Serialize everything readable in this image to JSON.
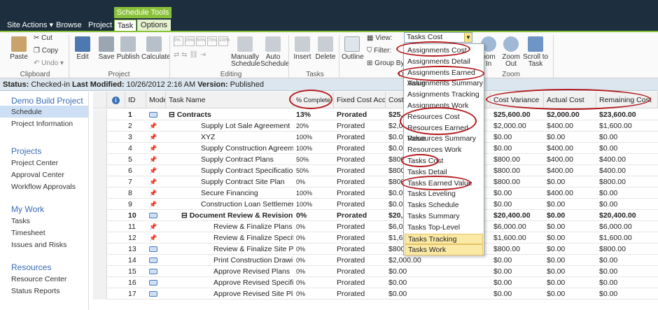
{
  "topbar": {
    "site_actions": "Site Actions ▾",
    "browse": "Browse",
    "project": "Project",
    "context_group": "Schedule Tools",
    "tab_task": "Task",
    "tab_options": "Options"
  },
  "ribbon": {
    "cut": "Cut",
    "copy": "Copy",
    "undo": "Undo",
    "paste": "Paste",
    "clipboard_group": "Clipboard",
    "edit": "Edit",
    "save": "Save",
    "publish": "Publish",
    "calculate": "Calculate",
    "project_group": "Project",
    "manually_schedule": "Manually Schedule",
    "auto_schedule": "Auto Schedule",
    "editing_group": "Editing",
    "insert": "Insert",
    "delete": "Delete",
    "tasks_group": "Tasks",
    "outline": "Outline",
    "view_label": "View:",
    "filter_label": "Filter:",
    "group_by_label": "Group By:",
    "data_group": "D",
    "zoom_in": "oom In",
    "zoom_out": "Zoom Out",
    "scroll_to_task": "Scroll to Task",
    "zoom_group": "Zoom",
    "percent_buttons": [
      "0%",
      "25%",
      "50%",
      "75%",
      "100%"
    ]
  },
  "status": {
    "status_label": "Status:",
    "status_value": "Checked-in",
    "modified_label": "Last Modified:",
    "modified_value": "10/26/2012 2:16 AM",
    "version_label": "Version:",
    "version_value": "Published"
  },
  "nav": {
    "project_title": "Demo Build Project",
    "schedule": "Schedule",
    "project_information": "Project Information",
    "projects_h": "Projects",
    "project_center": "Project Center",
    "approval_center": "Approval Center",
    "workflow_approvals": "Workflow Approvals",
    "mywork_h": "My Work",
    "tasks": "Tasks",
    "timesheet": "Timesheet",
    "issues_risks": "Issues and Risks",
    "resources_h": "Resources",
    "resource_center": "Resource Center",
    "status_reports": "Status Reports"
  },
  "view_dropdown": {
    "selected": "Tasks Cost",
    "options": [
      "Assignments Cost",
      "Assignments Detail",
      "Assignments Earned Value",
      "Assignments Summary",
      "Assignments Tracking",
      "Assignments Work",
      "Resources Cost",
      "Resources Earned Value",
      "Resources Summary",
      "Resources Work",
      "Tasks Cost",
      "Tasks Detail",
      "Tasks Earned Value",
      "Tasks Leveling",
      "Tasks Schedule",
      "Tasks Summary",
      "Tasks Top-Level",
      "Tasks Tracking",
      "Tasks Work"
    ]
  },
  "columns": {
    "id": "ID",
    "mode": "Mode",
    "task_name": "Task Name",
    "pct_complete": "% Complete",
    "fixed_cost_accrual": "Fixed Cost Accrual",
    "cost": "Cost",
    "cost_variance": "Cost Variance",
    "actual_cost": "Actual Cost",
    "remaining_cost": "Remaining Cost"
  },
  "rows": [
    {
      "id": "1",
      "name": "Contracts",
      "pct": "13%",
      "accrual": "Prorated",
      "cost": "$25,",
      "variance": "$25,600.00",
      "actual": "$2,000.00",
      "remaining": "$23,600.00",
      "summary": true,
      "level": 0,
      "mode": "auto"
    },
    {
      "id": "2",
      "name": "Supply Lot Sale Agreement",
      "pct": "20%",
      "accrual": "Prorated",
      "cost": "$2,0",
      "variance": "$2,000.00",
      "actual": "$400.00",
      "remaining": "$1,600.00",
      "summary": false,
      "level": 1,
      "mode": "manual"
    },
    {
      "id": "3",
      "name": "XYZ",
      "pct": "100%",
      "accrual": "Prorated",
      "cost": "$0.0",
      "variance": "$0.00",
      "actual": "$0.00",
      "remaining": "$0.00",
      "summary": false,
      "level": 1,
      "mode": "manual"
    },
    {
      "id": "4",
      "name": "Supply Construction Agreement",
      "pct": "100%",
      "accrual": "Prorated",
      "cost": "$0.0",
      "variance": "$0.00",
      "actual": "$400.00",
      "remaining": "$0.00",
      "summary": false,
      "level": 1,
      "mode": "manual"
    },
    {
      "id": "5",
      "name": "Supply Contract Plans",
      "pct": "50%",
      "accrual": "Prorated",
      "cost": "$800",
      "variance": "$800.00",
      "actual": "$400.00",
      "remaining": "$400.00",
      "summary": false,
      "level": 1,
      "mode": "manual"
    },
    {
      "id": "6",
      "name": "Supply Contract Specifications",
      "pct": "50%",
      "accrual": "Prorated",
      "cost": "$800",
      "variance": "$800.00",
      "actual": "$400.00",
      "remaining": "$400.00",
      "summary": false,
      "level": 1,
      "mode": "manual"
    },
    {
      "id": "7",
      "name": "Supply Contract Site Plan",
      "pct": "0%",
      "accrual": "Prorated",
      "cost": "$800",
      "variance": "$800.00",
      "actual": "$0.00",
      "remaining": "$800.00",
      "summary": false,
      "level": 1,
      "mode": "manual"
    },
    {
      "id": "8",
      "name": "Secure Financing",
      "pct": "100%",
      "accrual": "Prorated",
      "cost": "$0.0",
      "variance": "$0.00",
      "actual": "$400.00",
      "remaining": "$0.00",
      "summary": false,
      "level": 1,
      "mode": "manual"
    },
    {
      "id": "9",
      "name": "Construction Loan Settlement",
      "pct": "100%",
      "accrual": "Prorated",
      "cost": "$0.0",
      "variance": "$0.00",
      "actual": "$0.00",
      "remaining": "$0.00",
      "summary": false,
      "level": 1,
      "mode": "manual"
    },
    {
      "id": "10",
      "name": "Document Review & Revision",
      "pct": "0%",
      "accrual": "Prorated",
      "cost": "$20,",
      "variance": "$20,400.00",
      "actual": "$0.00",
      "remaining": "$20,400.00",
      "summary": true,
      "level": 1,
      "mode": "auto"
    },
    {
      "id": "11",
      "name": "Review & Finalize Plans",
      "pct": "0%",
      "accrual": "Prorated",
      "cost": "$6,0",
      "variance": "$6,000.00",
      "actual": "$0.00",
      "remaining": "$6,000.00",
      "summary": false,
      "level": 2,
      "mode": "manual"
    },
    {
      "id": "12",
      "name": "Review & Finalize Specifications",
      "pct": "0%",
      "accrual": "Prorated",
      "cost": "$1,6",
      "variance": "$1,600.00",
      "actual": "$0.00",
      "remaining": "$1,600.00",
      "summary": false,
      "level": 2,
      "mode": "manual"
    },
    {
      "id": "13",
      "name": "Review & Finalize Site Plan",
      "pct": "0%",
      "accrual": "Prorated",
      "cost": "$800",
      "variance": "$800.00",
      "actual": "$0.00",
      "remaining": "$800.00",
      "summary": false,
      "level": 2,
      "mode": "auto"
    },
    {
      "id": "14",
      "name": "Print Construction Drawings",
      "pct": "0%",
      "accrual": "Prorated",
      "cost": "$2,000.00",
      "variance": "$0.00",
      "actual": "$0.00",
      "remaining": "$0.00",
      "summary": false,
      "level": 2,
      "mode": "auto"
    },
    {
      "id": "15",
      "name": "Approve Revised Plans",
      "pct": "0%",
      "accrual": "Prorated",
      "cost": "$0.00",
      "variance": "$0.00",
      "actual": "$0.00",
      "remaining": "$0.00",
      "summary": false,
      "level": 2,
      "mode": "auto"
    },
    {
      "id": "16",
      "name": "Approve Revised Specifications",
      "pct": "0%",
      "accrual": "Prorated",
      "cost": "$0.00",
      "variance": "$0.00",
      "actual": "$0.00",
      "remaining": "$0.00",
      "summary": false,
      "level": 2,
      "mode": "auto"
    },
    {
      "id": "17",
      "name": "Approve Revised Site Plan",
      "pct": "0%",
      "accrual": "Prorated",
      "cost": "$0.00",
      "variance": "$0.00",
      "actual": "$0.00",
      "remaining": "$0.00",
      "summary": false,
      "level": 2,
      "mode": "auto"
    }
  ],
  "colors": {
    "accent_green": "#8ac13a",
    "annotation_red": "#b3191d",
    "highlight_yellow": "#fbe9a6",
    "link_blue": "#3a6db5"
  }
}
